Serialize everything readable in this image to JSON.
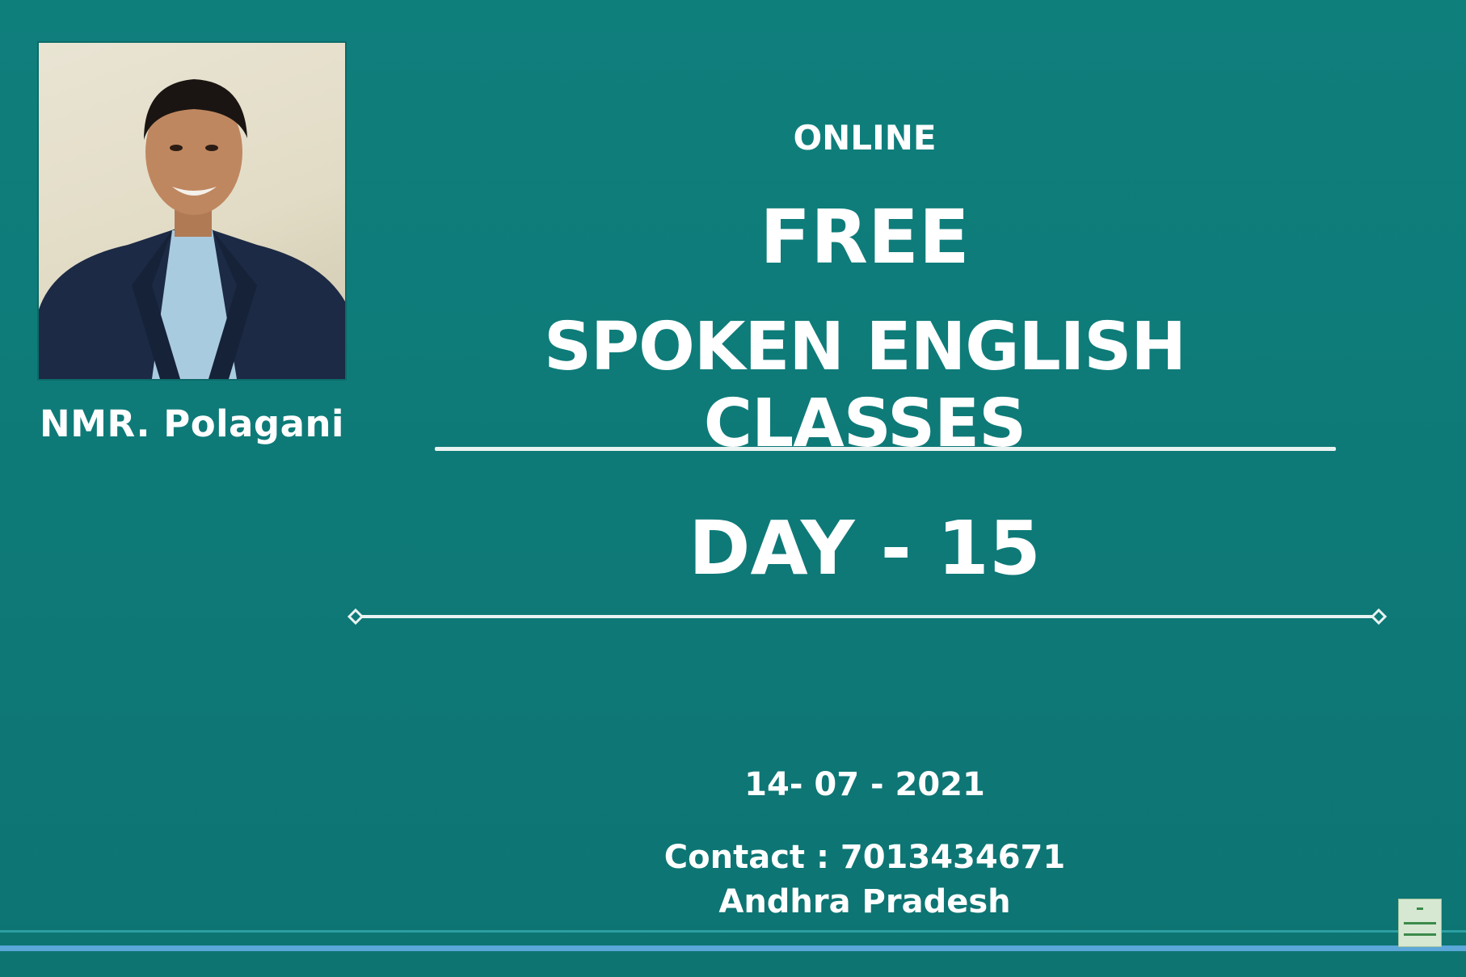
{
  "presenter": {
    "name": "NMR. Polagani"
  },
  "slide": {
    "online_label": "ONLINE",
    "free_label": "FREE",
    "title": "SPOKEN ENGLISH CLASSES",
    "day": "DAY - 15",
    "date": "14- 07 - 2021",
    "contact": "Contact : 7013434671",
    "location": "Andhra Pradesh"
  },
  "colors": {
    "background": "#0e7a78",
    "text": "#ffffff",
    "accent_line": "#5aa7d8"
  },
  "icons": {
    "presenter_photo": "person-portrait",
    "corner_logo": "channel-logo-icon"
  }
}
